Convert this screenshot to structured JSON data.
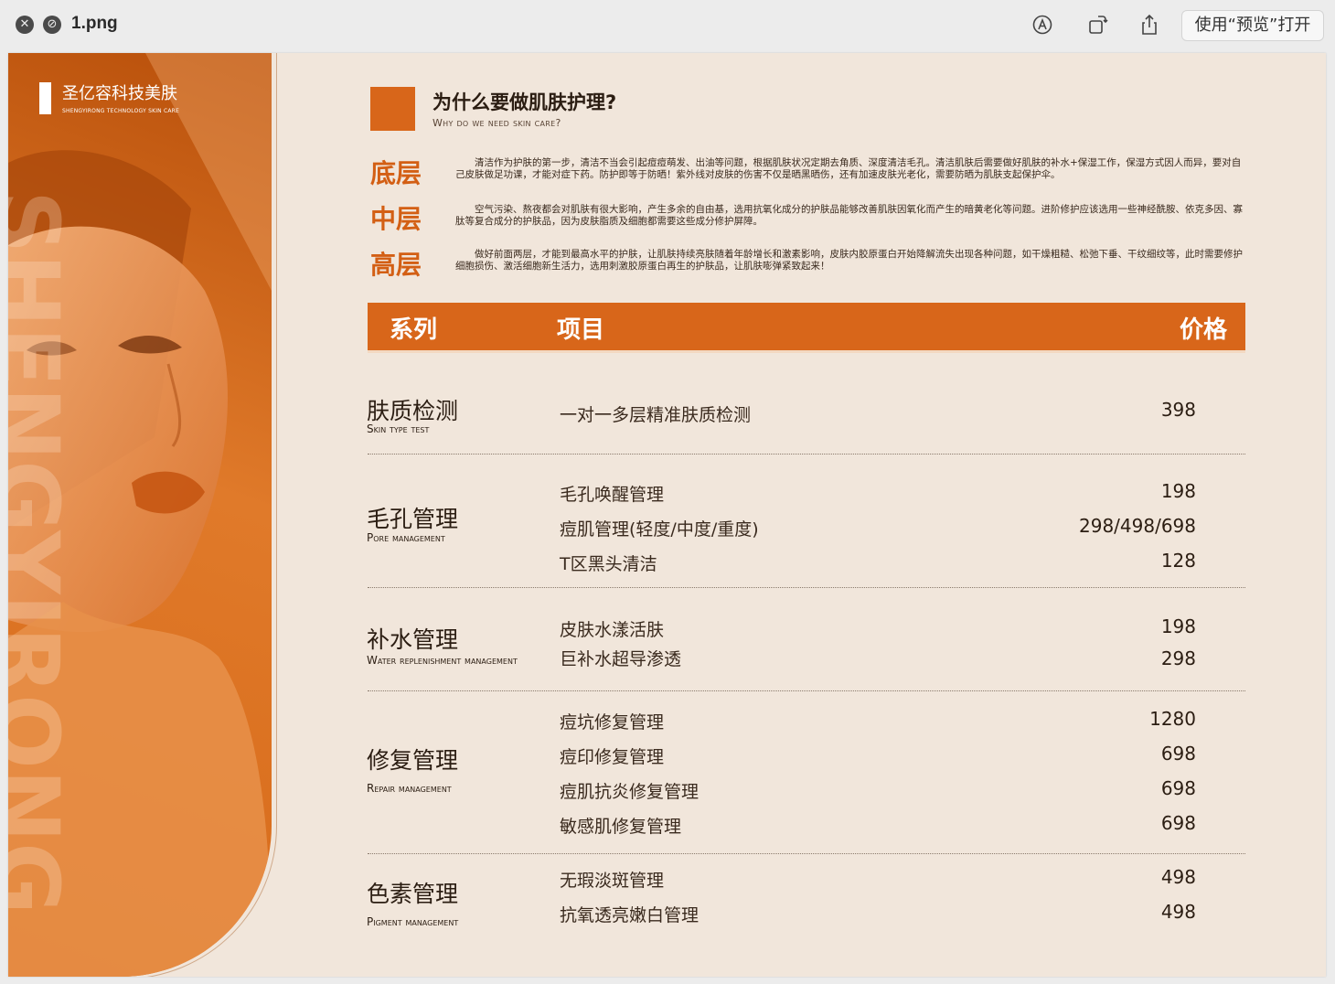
{
  "window": {
    "title": "1.png",
    "open_button": "使用“预览”打开",
    "icons": [
      "close-icon",
      "minimize-icon",
      "markup-icon",
      "rotate-icon",
      "share-icon"
    ]
  },
  "brand": {
    "name_cn": "圣亿容科技美肤",
    "name_en": "SHENGYIRONG TECHNOLOGY SKIN CARE",
    "vertical_text": "SHENGYIRONG"
  },
  "intro": {
    "title": "为什么要做肌肤护理?",
    "subtitle": "Why do we need skin care?",
    "layers": [
      {
        "label": "底层",
        "text": "清洁作为护肤的第一步，清洁不当会引起痘痘萌发、出油等问题，根据肌肤状况定期去角质、深度清洁毛孔。清洁肌肤后需要做好肌肤的补水+保湿工作，保湿方式因人而异，要对自己皮肤做足功课，才能对症下药。防护即等于防晒！紫外线对皮肤的伤害不仅是晒黑晒伤，还有加速皮肤光老化，需要防晒为肌肤支起保护伞。"
      },
      {
        "label": "中层",
        "text": "空气污染、熬夜都会对肌肤有很大影响，产生多余的自由基，选用抗氧化成分的护肤品能够改善肌肤因氧化而产生的暗黄老化等问题。进阶修护应该选用一些神经酰胺、依克多因、寡肽等复合成分的护肤品，因为皮肤脂质及细胞都需要这些成分修护屏障。"
      },
      {
        "label": "高层",
        "text": "做好前面两层，才能到最高水平的护肤，让肌肤持续亮肤随着年龄增长和激素影响，皮肤内胶原蛋白开始降解流失出现各种问题，如干燥粗糙、松弛下垂、干纹细纹等，此时需要修护细胞损伤、激活细胞新生活力，选用刺激胶原蛋白再生的护肤品，让肌肤嘭弹紧致起来！"
      }
    ]
  },
  "table": {
    "headers": {
      "series": "系列",
      "item": "项目",
      "price": "价格"
    },
    "categories": [
      {
        "cn": "肤质检测",
        "en": "Skin type test",
        "items": [
          {
            "name": "一对一多层精准肤质检测",
            "price": "398"
          }
        ]
      },
      {
        "cn": "毛孔管理",
        "en": "Pore management",
        "items": [
          {
            "name": "毛孔唤醒管理",
            "price": "198"
          },
          {
            "name": "痘肌管理(轻度/中度/重度)",
            "price": "298/498/698"
          },
          {
            "name": "T区黑头清洁",
            "price": "128"
          }
        ]
      },
      {
        "cn": "补水管理",
        "en": "Water replenishment management",
        "items": [
          {
            "name": "皮肤水漾活肤",
            "price": "198"
          },
          {
            "name": "巨补水超导渗透",
            "price": "298"
          }
        ]
      },
      {
        "cn": "修复管理",
        "en": "Repair management",
        "items": [
          {
            "name": "痘坑修复管理",
            "price": "1280"
          },
          {
            "name": "痘印修复管理",
            "price": "698"
          },
          {
            "name": "痘肌抗炎修复管理",
            "price": "698"
          },
          {
            "name": "敏感肌修复管理",
            "price": "698"
          }
        ]
      },
      {
        "cn": "色素管理",
        "en": "Pigment management",
        "items": [
          {
            "name": "无瑕淡斑管理",
            "price": "498"
          },
          {
            "name": "抗氧透亮嫩白管理",
            "price": "498"
          }
        ]
      }
    ]
  },
  "colors": {
    "accent": "#d8661a",
    "page_bg": "#f1e6db",
    "text": "#2b1d12"
  }
}
